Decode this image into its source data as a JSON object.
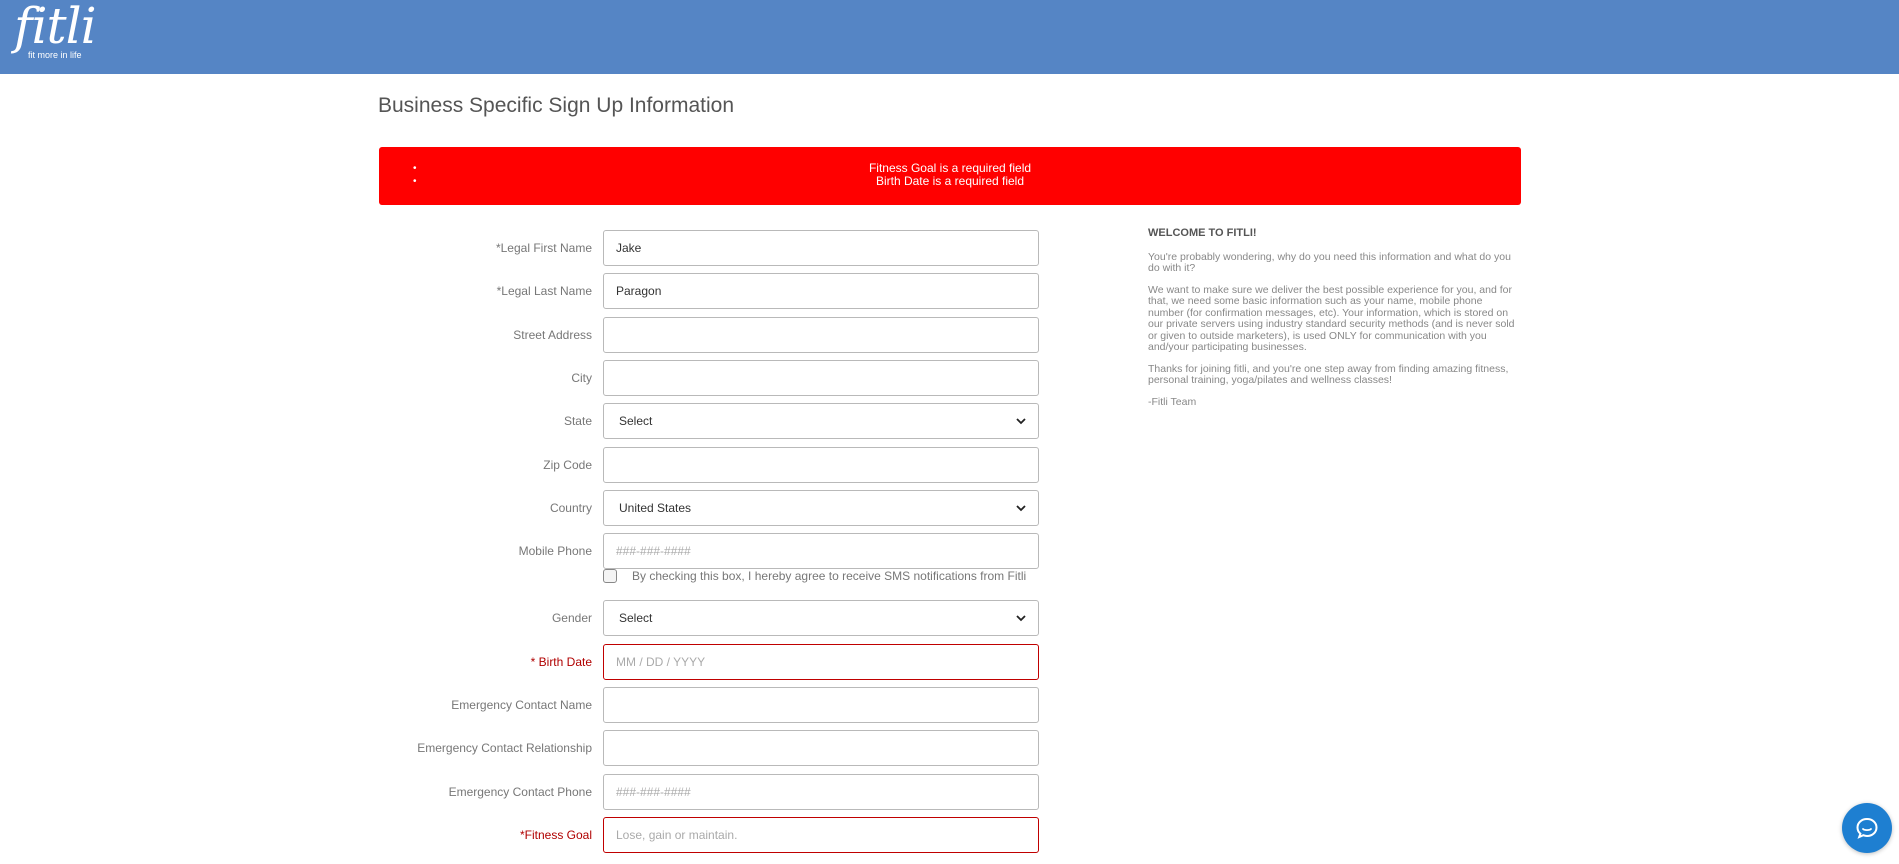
{
  "brand": {
    "logo_text": "fitli",
    "tagline": "fit more in life"
  },
  "page_title": "Business Specific Sign Up Information",
  "errors": [
    "Fitness Goal is a required field",
    "Birth Date is a required field"
  ],
  "error_bullet": "•",
  "form": {
    "first_name": {
      "label": "*Legal First Name",
      "value": "Jake",
      "placeholder": ""
    },
    "last_name": {
      "label": "*Legal Last Name",
      "value": "Paragon",
      "placeholder": ""
    },
    "street": {
      "label": "Street Address",
      "value": "",
      "placeholder": ""
    },
    "city": {
      "label": "City",
      "value": "",
      "placeholder": ""
    },
    "state": {
      "label": "State",
      "selected": "Select"
    },
    "zip": {
      "label": "Zip Code",
      "value": "",
      "placeholder": ""
    },
    "country": {
      "label": "Country",
      "selected": "United States"
    },
    "mobile": {
      "label": "Mobile Phone",
      "value": "",
      "placeholder": "###-###-####"
    },
    "sms_consent": {
      "label": "By checking this box, I hereby agree to receive SMS notifications from Fitli",
      "checked": false
    },
    "gender": {
      "label": "Gender",
      "selected": "Select"
    },
    "birth_date": {
      "label": "* Birth Date",
      "value": "",
      "placeholder": "MM / DD / YYYY"
    },
    "emergency_name": {
      "label": "Emergency Contact Name",
      "value": "",
      "placeholder": ""
    },
    "emergency_relationship": {
      "label": "Emergency Contact Relationship",
      "value": "",
      "placeholder": ""
    },
    "emergency_phone": {
      "label": "Emergency Contact Phone",
      "value": "",
      "placeholder": "###-###-####"
    },
    "fitness_goal": {
      "label": "*Fitness Goal",
      "value": "",
      "placeholder": "Lose, gain or maintain."
    }
  },
  "welcome": {
    "heading": "WELCOME TO FITLI!",
    "p1": "You're probably wondering, why do you need this information and what do you do with it?",
    "p2": "We want to make sure we deliver the best possible experience for you, and for that, we need some basic information such as your name, mobile phone number (for confirmation messages, etc).  Your information, which is stored on our private servers using industry standard security methods (and is never sold or given to outside marketers), is used ONLY for communication with you and/your participating businesses.",
    "p3": "Thanks for joining fitli, and you're one step away from finding amazing fitness, personal training, yoga/pilates and wellness classes!",
    "signature": "-Fitli Team"
  },
  "colors": {
    "header": "#5585c5",
    "error_bg": "#ff0000",
    "error_text": "#b00000",
    "chat": "#1e7fd1"
  },
  "icons": {
    "chevron": "chevron-down-icon",
    "chat": "chat-bubble-icon"
  }
}
